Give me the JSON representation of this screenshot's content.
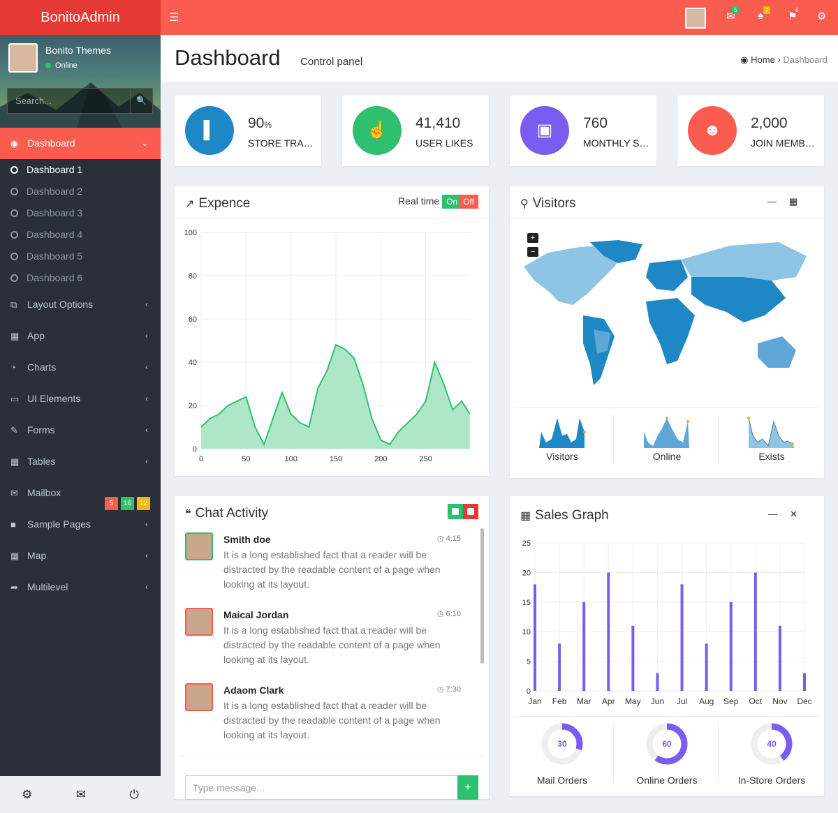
{
  "brand": "BonitoAdmin",
  "user": {
    "name": "Bonito Themes",
    "status": "Online"
  },
  "search": {
    "placeholder": "Search..."
  },
  "sidebar": {
    "dashboard": "Dashboard",
    "submenu": [
      "Dashboard 1",
      "Dashboard 2",
      "Dashboard 3",
      "Dashboard 4",
      "Dashboard 5",
      "Dashboard 6"
    ],
    "items": [
      "Layout Options",
      "App",
      "Charts",
      "UI Elements",
      "Forms",
      "Tables",
      "Mailbox",
      "Sample Pages",
      "Map",
      "Multilevel"
    ],
    "mailbox_badges": [
      "5",
      "16",
      "12"
    ]
  },
  "topbar": {
    "mail_count": "5",
    "notif_count": "7",
    "flag_count": "6"
  },
  "header": {
    "title": "Dashboard",
    "subtitle": "Control panel",
    "crumb_home": "Home",
    "crumb_current": "Dashboard"
  },
  "stats": [
    {
      "value": "90",
      "unit": "%",
      "label": "STORE TRAFFIC",
      "color": "#1e88c7",
      "icon": "bar-chart-icon"
    },
    {
      "value": "41,410",
      "unit": "",
      "label": "USER LIKES",
      "color": "#2ec06f",
      "icon": "thumbs-up-icon"
    },
    {
      "value": "760",
      "unit": "",
      "label": "MONTHLY SALES",
      "color": "#7a5cf0",
      "icon": "shopping-bag-icon"
    },
    {
      "value": "2,000",
      "unit": "",
      "label": "JOIN MEMBERS",
      "color": "#fa5c4f",
      "icon": "users-icon"
    }
  ],
  "expence": {
    "title": "Expence",
    "realtime": "Real time",
    "on": "On",
    "off": "Off"
  },
  "visitors": {
    "title": "Visitors",
    "sparks": [
      "Visitors",
      "Online",
      "Exists"
    ]
  },
  "chat": {
    "title": "Chat Activity",
    "messages": [
      {
        "name": "Smith doe",
        "time": "4:15",
        "text": "It is a long established fact that a reader will be distracted by the readable content of a page when looking at its layout."
      },
      {
        "name": "Maical Jordan",
        "time": "6:10",
        "text": "It is a long established fact that a reader will be distracted by the readable content of a page when looking at its layout."
      },
      {
        "name": "Adaom Clark",
        "time": "7:30",
        "text": "It is a long established fact that a reader will be distracted by the readable content of a page when looking at its layout."
      }
    ],
    "input_placeholder": "Type message..."
  },
  "sales": {
    "title": "Sales Graph",
    "donuts": [
      {
        "value": "30",
        "label": "Mail Orders",
        "pct": 30
      },
      {
        "value": "60",
        "label": "Online Orders",
        "pct": 60
      },
      {
        "value": "40",
        "label": "In-Store Orders",
        "pct": 40
      }
    ]
  },
  "chart_data": [
    {
      "type": "area",
      "x_ticks": [
        "0",
        "50",
        "100",
        "150",
        "200",
        "250"
      ],
      "y_ticks": [
        "0",
        "20",
        "40",
        "60",
        "80",
        "100"
      ],
      "ylim": [
        0,
        100
      ],
      "xlim": [
        0,
        300
      ],
      "color": "#2ec06f",
      "x": [
        0,
        10,
        20,
        30,
        40,
        50,
        60,
        70,
        80,
        90,
        100,
        110,
        120,
        130,
        140,
        150,
        160,
        170,
        180,
        190,
        200,
        210,
        220,
        230,
        240,
        250,
        260,
        270,
        280,
        290,
        299
      ],
      "y": [
        10,
        14,
        16,
        20,
        22,
        24,
        10,
        2,
        14,
        26,
        16,
        12,
        10,
        28,
        36,
        48,
        46,
        42,
        30,
        14,
        4,
        2,
        8,
        12,
        16,
        22,
        40,
        30,
        18,
        22,
        16
      ]
    },
    {
      "type": "bar",
      "categories": [
        "Jan",
        "Feb",
        "Mar",
        "Apr",
        "May",
        "Jun",
        "Jul",
        "Aug",
        "Sep",
        "Oct",
        "Nov",
        "Dec"
      ],
      "values": [
        18,
        8,
        15,
        20,
        11,
        3,
        18,
        8,
        15,
        20,
        11,
        3
      ],
      "y_ticks": [
        "0",
        "5",
        "10",
        "15",
        "20",
        "25"
      ],
      "ylim": [
        0,
        25
      ],
      "color": "#7a5cf0"
    }
  ]
}
